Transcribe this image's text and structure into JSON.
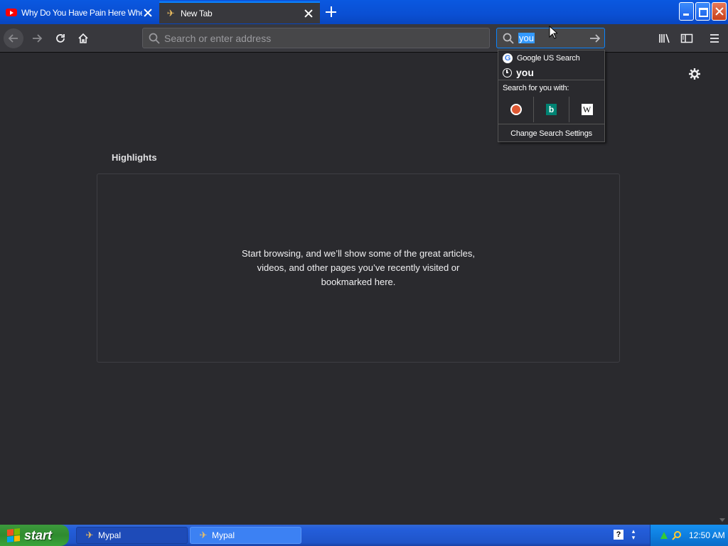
{
  "tabs": [
    {
      "title": "Why Do You Have Pain Here When",
      "icon": "youtube-icon"
    },
    {
      "title": "New Tab",
      "icon": "mypal-icon"
    }
  ],
  "urlbar": {
    "placeholder": "Search or enter address"
  },
  "searchbar": {
    "value": "you"
  },
  "dropdown": {
    "engine_label": "Google US Search",
    "history_item": "you",
    "search_for_label": "Search for you with:",
    "engines": [
      "duckduckgo-icon",
      "bing-icon",
      "wikipedia-icon"
    ],
    "bing_glyph": "b",
    "wiki_glyph": "W",
    "settings_label": "Change Search Settings"
  },
  "highlights": {
    "title": "Highlights",
    "empty_message": "Start browsing, and we’ll show some of the great articles, videos, and other pages you’ve recently visited or bookmarked here."
  },
  "taskbar": {
    "start_label": "start",
    "tasks": [
      {
        "label": "Mypal"
      },
      {
        "label": "Mypal"
      }
    ],
    "help_glyph": "?",
    "clock": "12:50 AM"
  },
  "colors": {
    "accent": "#0a84ff",
    "page_bg": "#2a2a2e",
    "toolbar_bg": "#38383d"
  }
}
